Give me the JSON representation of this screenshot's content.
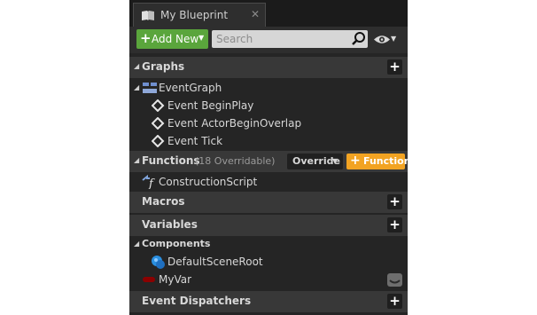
{
  "tab": {
    "title": "My Blueprint",
    "close": "✕",
    "icon": "book-icon"
  },
  "toolbar": {
    "add_new_label": "Add New",
    "search_placeholder": "Search",
    "colors": {
      "add_new": "#5aa53c",
      "function": "#f2a322"
    }
  },
  "graphs": {
    "title": "Graphs",
    "event_graph": "EventGraph",
    "events": [
      "Event BeginPlay",
      "Event ActorBeginOverlap",
      "Event Tick"
    ]
  },
  "functions": {
    "title": "Functions",
    "overridable": "(18 Overridable)",
    "override_label": "Override",
    "function_label": "Function",
    "items": [
      "ConstructionScript"
    ]
  },
  "macros": {
    "title": "Macros"
  },
  "variables": {
    "title": "Variables",
    "components_title": "Components",
    "components": [
      "DefaultSceneRoot"
    ],
    "items": [
      "MyVar"
    ]
  },
  "event_dispatchers": {
    "title": "Event Dispatchers"
  }
}
